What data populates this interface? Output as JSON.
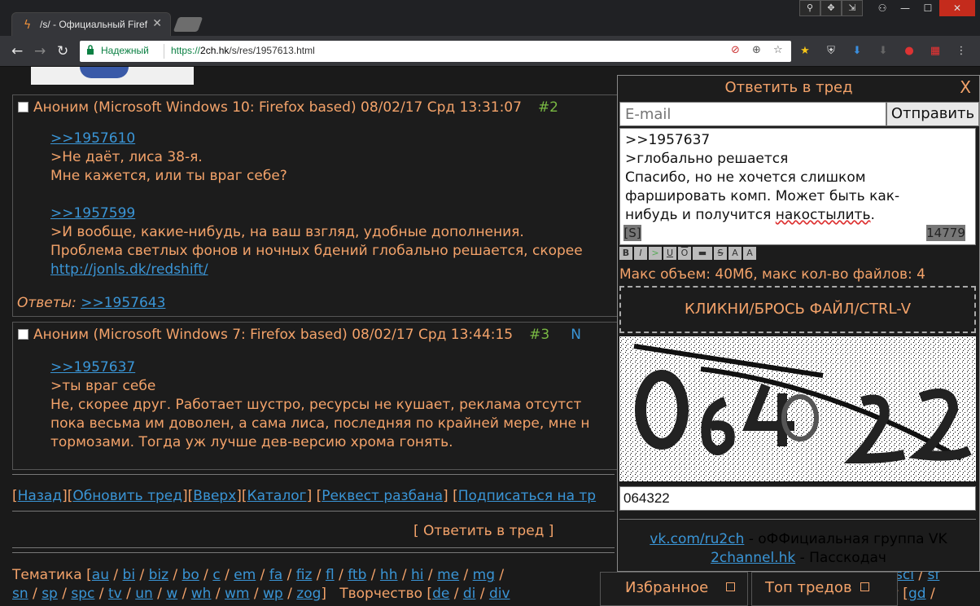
{
  "browser": {
    "tab_title": "/s/ - Официальный Firef",
    "secure_label": "Надежный",
    "url_scheme": "https://",
    "url_host": "2ch.hk",
    "url_path": "/s/res/1957613.html"
  },
  "posts": [
    {
      "header": "Аноним (Microsoft Windows 10: Firefox based) 08/02/17 Срд 13:31:07",
      "number": "#2",
      "lines": [
        {
          "type": "link",
          "text": ">>1957610"
        },
        {
          "type": "text",
          "text": ">Не даёт, лиса 38-я."
        },
        {
          "type": "text",
          "text": "Мне кажется, или ты враг себе?"
        },
        {
          "type": "blank",
          "text": ""
        },
        {
          "type": "link",
          "text": ">>1957599"
        },
        {
          "type": "text",
          "text": ">И вообще, какие-нибудь, на ваш взгляд, удобные дополнения."
        },
        {
          "type": "text",
          "text": "Проблема светлых фонов и ночных бдений глобально решается, скорее"
        },
        {
          "type": "link",
          "text": "http://jonls.dk/redshift/"
        }
      ],
      "answers_label": "Ответы:",
      "answers_link": ">>1957643"
    },
    {
      "header": "Аноним (Microsoft Windows 7: Firefox based) 08/02/17 Срд 13:44:15",
      "number": "#3",
      "number_suffix": "N",
      "lines": [
        {
          "type": "link",
          "text": ">>1957637"
        },
        {
          "type": "text",
          "text": ">ты враг себе"
        },
        {
          "type": "text",
          "text": "Не, скорее друг. Работает шустро, ресурсы не кушает, реклама отсутст"
        },
        {
          "type": "text",
          "text": "пока весьма им доволен, а сама лиса, последняя по крайней мере, мне н"
        },
        {
          "type": "text",
          "text": "тормозами. Тогда уж лучше дев-версию хрома гонять."
        }
      ]
    }
  ],
  "nav": {
    "back": "Назад",
    "refresh": "Обновить тред",
    "up": "Вверх",
    "catalog": "Каталог",
    "request": "Реквест разбана",
    "subscribe": "Подписаться на тр"
  },
  "reply_bottom": "[ Ответить в тред ]",
  "boards_line1": {
    "label": "Тематика",
    "boards": [
      "au",
      "bi",
      "biz",
      "bo",
      "c",
      "em",
      "fa",
      "fiz",
      "fl",
      "ftb",
      "hh",
      "hi",
      "me",
      "mg"
    ],
    "tail": [
      "sci",
      "sf"
    ]
  },
  "boards_line2": {
    "boards": [
      "sn",
      "sp",
      "spc",
      "tv",
      "un",
      "w",
      "wh",
      "wm",
      "wp",
      "zog"
    ],
    "label2": "Творчество",
    "boards2": [
      "de",
      "di",
      "div"
    ],
    "tail_text": "т [",
    "tail_boards": [
      "gd"
    ]
  },
  "reply_panel": {
    "title": "Ответить в тред",
    "close": "X",
    "email_placeholder": "E-mail",
    "send_label": "Отправить",
    "message_lines": [
      ">>1957637",
      ">глобально решается",
      "Спасибо, но не хочется слишком",
      "фаршировать комп. Может быть как-"
    ],
    "message_last_before": "нибудь и получится ",
    "message_last_underlined": "накостылить",
    "message_last_after": ".",
    "spoiler_label": "[S]",
    "char_counter": "14779",
    "format_buttons": [
      "B",
      "I",
      ">",
      "U",
      "O",
      "▬",
      "S",
      "A",
      "A"
    ],
    "limits": "Макс объем: 40Мб, макс кол-во файлов: 4",
    "dropzone": "КЛИКНИ/БРОСЬ ФАЙЛ/CTRL-V",
    "captcha_value": "064322",
    "vk_link": "vk.com/ru2ch",
    "vk_text": " - оФФициальная группа VK",
    "pass_link": "2channel.hk",
    "pass_text": " - Пасскодач"
  },
  "bottom_tabs": {
    "favorites": "Избранное",
    "top_threads": "Топ тредов"
  },
  "colors": {
    "accent": "#f4a36a",
    "link": "#3a95d6",
    "post_number": "#79b943",
    "background": "#1a1a1a"
  }
}
